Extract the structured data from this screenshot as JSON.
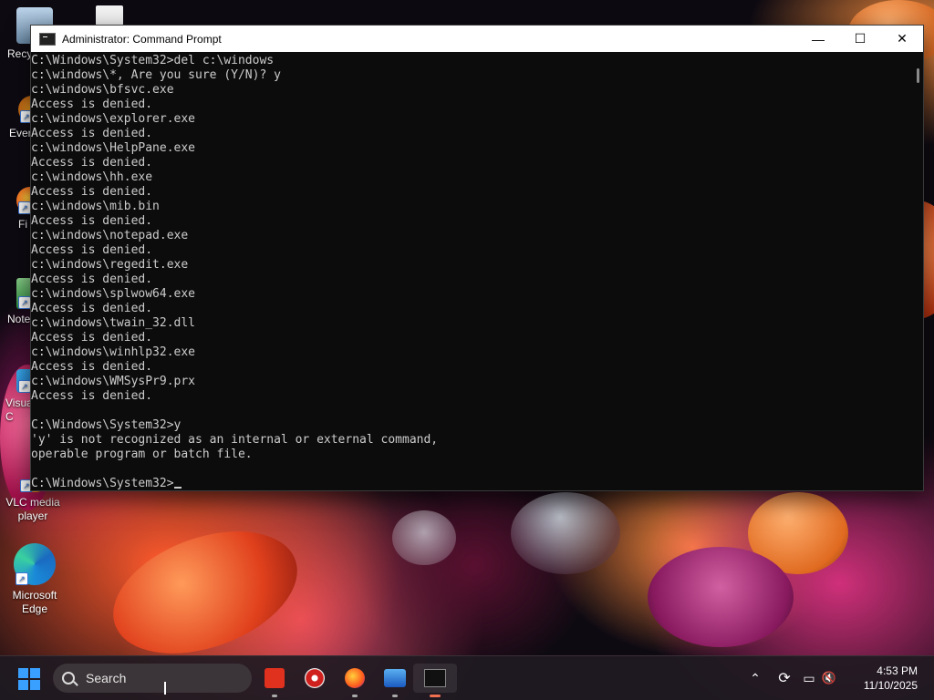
{
  "desktop": {
    "icons": [
      {
        "label": "Recy"
      },
      {
        "label": "Ever"
      },
      {
        "label": "Fi"
      },
      {
        "label": "Note"
      },
      {
        "label": "Visua\nC"
      },
      {
        "label": "VLC media\nplayer"
      },
      {
        "label": "Microsoft\nEdge"
      }
    ]
  },
  "cmd_window": {
    "title": "Administrator: Command Prompt",
    "buttons": {
      "minimize": "—",
      "maximize": "☐",
      "close": "✕"
    },
    "lines": [
      "C:\\Windows\\System32>del c:\\windows",
      "c:\\windows\\*, Are you sure (Y/N)? y",
      "c:\\windows\\bfsvc.exe",
      "Access is denied.",
      "c:\\windows\\explorer.exe",
      "Access is denied.",
      "c:\\windows\\HelpPane.exe",
      "Access is denied.",
      "c:\\windows\\hh.exe",
      "Access is denied.",
      "c:\\windows\\mib.bin",
      "Access is denied.",
      "c:\\windows\\notepad.exe",
      "Access is denied.",
      "c:\\windows\\regedit.exe",
      "Access is denied.",
      "c:\\windows\\splwow64.exe",
      "Access is denied.",
      "c:\\windows\\twain_32.dll",
      "Access is denied.",
      "c:\\windows\\winhlp32.exe",
      "Access is denied.",
      "c:\\windows\\WMSysPr9.prx",
      "Access is denied.",
      "",
      "C:\\Windows\\System32>y",
      "'y' is not recognized as an internal or external command,",
      "operable program or batch file.",
      "",
      "C:\\Windows\\System32>"
    ]
  },
  "taskbar": {
    "search_placeholder": "Search",
    "apps": [
      {
        "name": "anydesk-icon"
      },
      {
        "name": "app-icon"
      },
      {
        "name": "firefox-icon"
      },
      {
        "name": "photos-icon"
      },
      {
        "name": "terminal-icon"
      }
    ],
    "clock": {
      "time": "4:53 PM",
      "date": "11/10/2025"
    }
  }
}
